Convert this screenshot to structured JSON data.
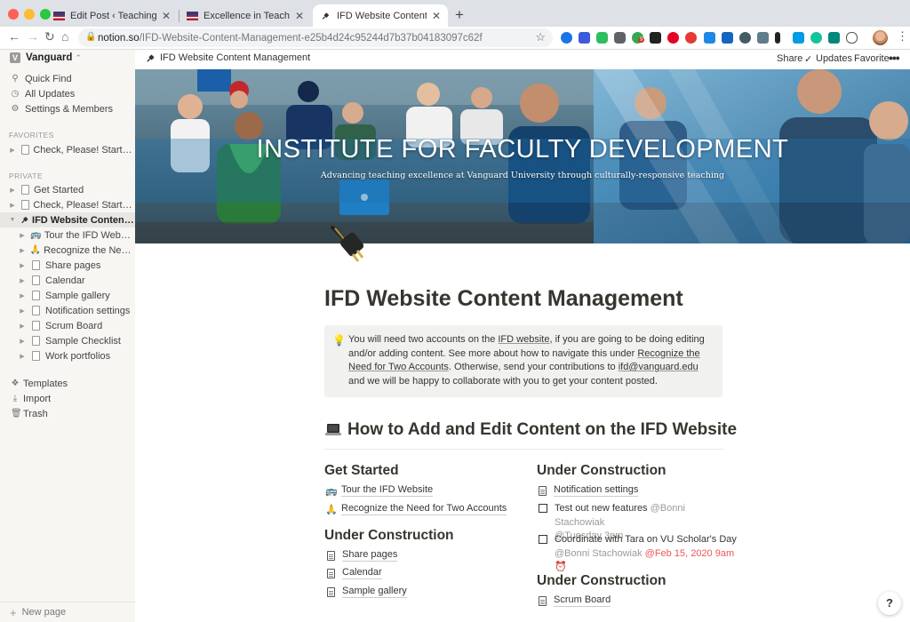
{
  "browser": {
    "tabs": [
      {
        "title": "Edit Post ‹ Teaching in Higher Ed"
      },
      {
        "title": "Excellence in Teaching Luncheon"
      },
      {
        "title": "IFD Website Content Management"
      }
    ],
    "url_host": "notion.so",
    "url_path": "/IFD-Website-Content-Management-e25b4d24c95244d7b37b04183097c62f",
    "extension_badge": "9"
  },
  "sidebar": {
    "workspace": "Vanguard",
    "top_items": [
      {
        "label": "Quick Find",
        "icon": "search-icon"
      },
      {
        "label": "All Updates",
        "icon": "clock-icon"
      },
      {
        "label": "Settings & Members",
        "icon": "gear-icon"
      }
    ],
    "favorites_heading": "FAVORITES",
    "favorites": [
      {
        "label": "Check, Please! Starter ..."
      }
    ],
    "private_heading": "PRIVATE",
    "private": [
      {
        "label": "Get Started"
      },
      {
        "label": "Check, Please! Starter ..."
      },
      {
        "label": "IFD Website Content M..."
      }
    ],
    "children": [
      {
        "label": "Tour the IFD Website",
        "emoji": "🚌"
      },
      {
        "label": "Recognize the Need f...",
        "emoji": "🙏"
      },
      {
        "label": "Share pages"
      },
      {
        "label": "Calendar"
      },
      {
        "label": "Sample gallery"
      },
      {
        "label": "Notification settings"
      },
      {
        "label": "Scrum Board"
      },
      {
        "label": "Sample Checklist"
      },
      {
        "label": "Work portfolios"
      }
    ],
    "bottom_items": [
      {
        "label": "Templates",
        "icon": "templates-icon"
      },
      {
        "label": "Import",
        "icon": "import-icon"
      },
      {
        "label": "Trash",
        "icon": "trash-icon"
      }
    ],
    "new_page": "New page"
  },
  "topbar": {
    "breadcrumb": "IFD Website Content Management",
    "share": "Share",
    "updates": "Updates",
    "favorite": "Favorite"
  },
  "cover": {
    "title": "INSTITUTE FOR FACULTY DEVELOPMENT",
    "subtitle": "Advancing teaching excellence at Vanguard University through culturally-responsive teaching"
  },
  "page": {
    "title": "IFD Website Content Management",
    "callout": {
      "t1": "You will need two accounts on the ",
      "link1": "IFD website",
      "t2": ", if you are going to be doing editing and/or adding content. See more about how to navigate this under ",
      "link2": "Recognize the Need for Two Accounts",
      "t3": ". Otherwise, send your contributions to ",
      "link3": "ifd@vanguard.edu",
      "t4": " and we will be happy to collaborate with you to get your content posted."
    },
    "heading": "How to Add and Edit Content on the IFD Website",
    "left": {
      "get_started": "Get Started",
      "tour": "Tour the IFD Website",
      "recognize": "Recognize the Need for Two Accounts",
      "under_construction": "Under Construction",
      "share_pages": "Share pages",
      "calendar": "Calendar",
      "sample_gallery": "Sample gallery"
    },
    "right": {
      "under_construction_1": "Under Construction",
      "notification_settings": "Notification settings",
      "todo1_text": "Test out new features ",
      "todo1_mention": "@Bonni Stachowiak",
      "todo1_date": "@Tuesday 3pm",
      "todo2_text": "Coordinate with Tara on VU Scholar's Day ",
      "todo2_mention": "@Bonni Stachowiak",
      "todo2_date": "@Feb 15, 2020 9am",
      "under_construction_2": "Under Construction",
      "scrum_board": "Scrum Board"
    }
  },
  "help": "?"
}
